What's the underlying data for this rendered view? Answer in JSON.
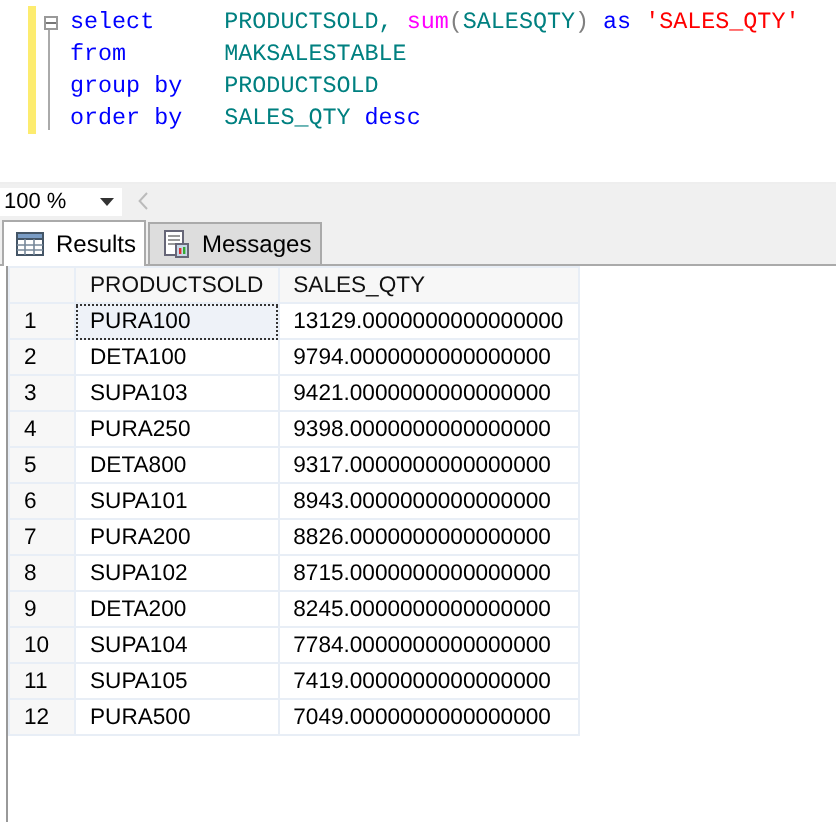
{
  "editor": {
    "lines": [
      {
        "clause": "select",
        "args": [
          {
            "kind": "identifier",
            "text": "PRODUCTSOLD, "
          },
          {
            "kind": "function",
            "text": "sum"
          },
          {
            "kind": "plain",
            "text": "("
          },
          {
            "kind": "identifier",
            "text": "SALESQTY"
          },
          {
            "kind": "plain",
            "text": ") "
          },
          {
            "kind": "keyword",
            "text": "as "
          },
          {
            "kind": "string",
            "text": "'SALES_QTY'"
          }
        ]
      },
      {
        "clause": "from",
        "args": [
          {
            "kind": "identifier",
            "text": "MAKSALESTABLE"
          }
        ]
      },
      {
        "clause": "group by",
        "args": [
          {
            "kind": "identifier",
            "text": "PRODUCTSOLD"
          }
        ]
      },
      {
        "clause": "order by",
        "args": [
          {
            "kind": "identifier",
            "text": "SALES_QTY "
          },
          {
            "kind": "keyword",
            "text": "desc"
          }
        ]
      }
    ]
  },
  "zoom": {
    "value": "100 %"
  },
  "tabs": [
    {
      "label": "Results",
      "selected": true
    },
    {
      "label": "Messages",
      "selected": false
    }
  ],
  "grid": {
    "columns": [
      "PRODUCTSOLD",
      "SALES_QTY"
    ],
    "rows": [
      {
        "number": "1",
        "cells": [
          "PURA100",
          "13129.0000000000000000"
        ],
        "selected": true
      },
      {
        "number": "2",
        "cells": [
          "DETA100",
          "9794.0000000000000000"
        ],
        "selected": false
      },
      {
        "number": "3",
        "cells": [
          "SUPA103",
          "9421.0000000000000000"
        ],
        "selected": false
      },
      {
        "number": "4",
        "cells": [
          "PURA250",
          "9398.0000000000000000"
        ],
        "selected": false
      },
      {
        "number": "5",
        "cells": [
          "DETA800",
          "9317.0000000000000000"
        ],
        "selected": false
      },
      {
        "number": "6",
        "cells": [
          "SUPA101",
          "8943.0000000000000000"
        ],
        "selected": false
      },
      {
        "number": "7",
        "cells": [
          "PURA200",
          "8826.0000000000000000"
        ],
        "selected": false
      },
      {
        "number": "8",
        "cells": [
          "SUPA102",
          "8715.0000000000000000"
        ],
        "selected": false
      },
      {
        "number": "9",
        "cells": [
          "DETA200",
          "8245.0000000000000000"
        ],
        "selected": false
      },
      {
        "number": "10",
        "cells": [
          "SUPA104",
          "7784.0000000000000000"
        ],
        "selected": false
      },
      {
        "number": "11",
        "cells": [
          "SUPA105",
          "7419.0000000000000000"
        ],
        "selected": false
      },
      {
        "number": "12",
        "cells": [
          "PURA500",
          "7049.0000000000000000"
        ],
        "selected": false
      }
    ]
  }
}
